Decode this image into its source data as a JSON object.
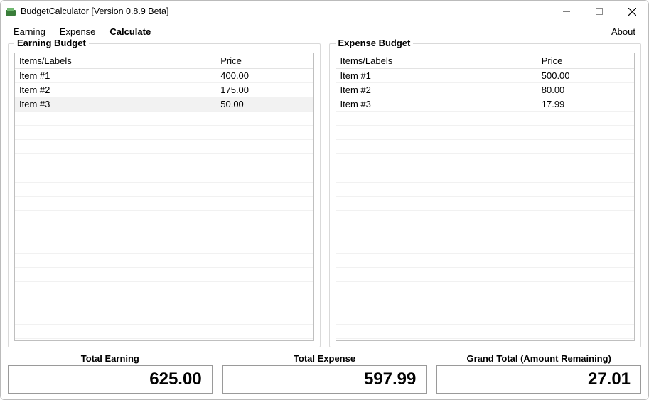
{
  "window": {
    "title": "BudgetCalculator [Version 0.8.9 Beta]"
  },
  "menu": {
    "earning": "Earning",
    "expense": "Expense",
    "calculate": "Calculate",
    "about": "About"
  },
  "earning_panel": {
    "legend": "Earning Budget",
    "header_item": "Items/Labels",
    "header_price": "Price",
    "rows": [
      {
        "label": "Item #1",
        "price": "400.00"
      },
      {
        "label": "Item #2",
        "price": "175.00"
      },
      {
        "label": "Item #3",
        "price": "50.00"
      }
    ]
  },
  "expense_panel": {
    "legend": "Expense Budget",
    "header_item": "Items/Labels",
    "header_price": "Price",
    "rows": [
      {
        "label": "Item #1",
        "price": "500.00"
      },
      {
        "label": "Item #2",
        "price": "80.00"
      },
      {
        "label": "Item #3",
        "price": "17.99"
      }
    ]
  },
  "totals": {
    "earning_label": "Total Earning",
    "earning_value": "625.00",
    "expense_label": "Total Expense",
    "expense_value": "597.99",
    "grand_label": "Grand Total (Amount Remaining)",
    "grand_value": "27.01"
  }
}
